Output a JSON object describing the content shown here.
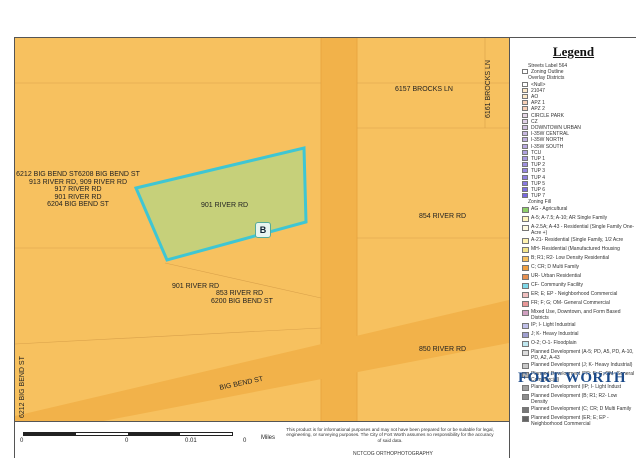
{
  "map": {
    "parcel_label": "901 RIVER RD",
    "marker": "B",
    "labels": {
      "brocks_ln": "6157 BROCKS LN",
      "brocks_ln_vertical": "6161 BROCKS LN",
      "river_854": "854 RIVER RD",
      "river_850": "850 RIVER RD",
      "river_901_south": "901 RIVER RD",
      "river_853": "853 RIVER RD",
      "big_bend_6200": "6200 BIG BEND ST",
      "big_bend_road": "BIG BEND ST",
      "big_bend_6212_vertical": "6212 BIG BEND ST"
    },
    "address_stack": [
      "6212 BIG BEND ST6208 BIG BEND ST",
      "913 RIVER RD, 909 RIVER RD",
      "917 RIVER RD",
      "901 RIVER RD",
      "6204 BIG BEND ST"
    ],
    "colors": {
      "zoning_fill": "#f7c15f",
      "parcel_fill": "#c6d07a",
      "parcel_outline": "#3fc6d3",
      "road": "#f2b24a"
    }
  },
  "legend": {
    "title": "Legend",
    "streets": "Streets Label 564",
    "zoning_outline": "Zoning Outline",
    "overlay_title": "Overlay Districts",
    "overlays": [
      {
        "label": "<Null>",
        "color": "#ffffff"
      },
      {
        "label": "21047",
        "color": "#fde9c9"
      },
      {
        "label": "AO",
        "color": "#fde9c9"
      },
      {
        "label": "APZ 1",
        "color": "#f8d0b8"
      },
      {
        "label": "APZ 2",
        "color": "#f8d0b8"
      },
      {
        "label": "CIRCLE PARK",
        "color": "#e8d8e8"
      },
      {
        "label": "CZ",
        "color": "#e0d0e8"
      },
      {
        "label": "DOWNTOWN URBAN",
        "color": "#d0c0e0"
      },
      {
        "label": "I-35W CENTRAL",
        "color": "#c8b8e0"
      },
      {
        "label": "I-35W NORTH",
        "color": "#c0b0e0"
      },
      {
        "label": "I-35W SOUTH",
        "color": "#b8a8e0"
      },
      {
        "label": "TCU",
        "color": "#b0a0e0"
      },
      {
        "label": "TUP 1",
        "color": "#a898e0"
      },
      {
        "label": "TUP 2",
        "color": "#a090e0"
      },
      {
        "label": "TUP 3",
        "color": "#9888e0"
      },
      {
        "label": "TUP 4",
        "color": "#9080e0"
      },
      {
        "label": "TUP 5",
        "color": "#8878e0"
      },
      {
        "label": "TUP 6",
        "color": "#8070e0"
      },
      {
        "label": "TUP 7",
        "color": "#7868e0"
      }
    ],
    "zoning_fill_title": "Zoning Fill",
    "zoning_fills": [
      {
        "label": "AG - Agricultural",
        "color": "#8fd06a"
      },
      {
        "label": "A-5; A-7.5; A-10; AR Single Family",
        "color": "#fff7c0"
      },
      {
        "label": "A-2.5A; A-43 - Residential (Single Family One-Acre +)",
        "color": "#fffbe0"
      },
      {
        "label": "A-21- Residential (Single Family, 1/2 Acre",
        "color": "#fff3b0"
      },
      {
        "label": "MH- Residential (Manufactured Housing",
        "color": "#f3e58a"
      },
      {
        "label": "B; R1; R2- Low Density Residential",
        "color": "#f7c15f"
      },
      {
        "label": "C; CR; D Multi Family",
        "color": "#f0a040"
      },
      {
        "label": "UR- Urban Residential",
        "color": "#e89050"
      },
      {
        "label": "CF- Community Facility",
        "color": "#80d8e8"
      },
      {
        "label": "ER; E; EP - Neighborhood Commercial",
        "color": "#f0c0c0"
      },
      {
        "label": "FR; F; G; OM- General Commercial",
        "color": "#e89898"
      },
      {
        "label": "Mixed Use, Downtown, and Form Based Districts",
        "color": "#d0a0c0"
      },
      {
        "label": "IP; I- Light Industrial",
        "color": "#c0c0e8"
      },
      {
        "label": "J; K- Heavy Industrial",
        "color": "#a0a0d0"
      },
      {
        "label": "O-2; O-1- Floodplain",
        "color": "#c0e8f0"
      },
      {
        "label": "Planned Development (A-5; PD, A5, PD, A-10, PD, A2, A-43",
        "color": "#dcdcdc"
      },
      {
        "label": "Planned Development (J; K- Heavy Industrial)",
        "color": "#c8c8c8"
      },
      {
        "label": "Planned Development (FR; F; G; OM- General Commercial)",
        "color": "#b4b4b4"
      },
      {
        "label": "Planned Development (IP; I- Light Indust",
        "color": "#a0a0a0"
      },
      {
        "label": "Planned Development (B; R1; R2- Low Density",
        "color": "#8c8c8c"
      },
      {
        "label": "Planned Development (C; CR; D Multi Family",
        "color": "#787878"
      },
      {
        "label": "Planned Development (ER; E; EP - Neighborhood Commercial",
        "color": "#646464"
      }
    ]
  },
  "footer": {
    "scale_ticks": [
      "0",
      "0",
      "0.01",
      "0"
    ],
    "scale_unit": "Miles",
    "disclaimer": "This product is for informational purposes and may not have been prepared for or be suitable for legal, engineering, or surveying purposes. The City of Fort Worth assumes no responsibility for the accuracy of said data.",
    "credit": "NCTCOG ORTHOPHOTOGRAPHY",
    "logo": "FORT WORTH"
  }
}
